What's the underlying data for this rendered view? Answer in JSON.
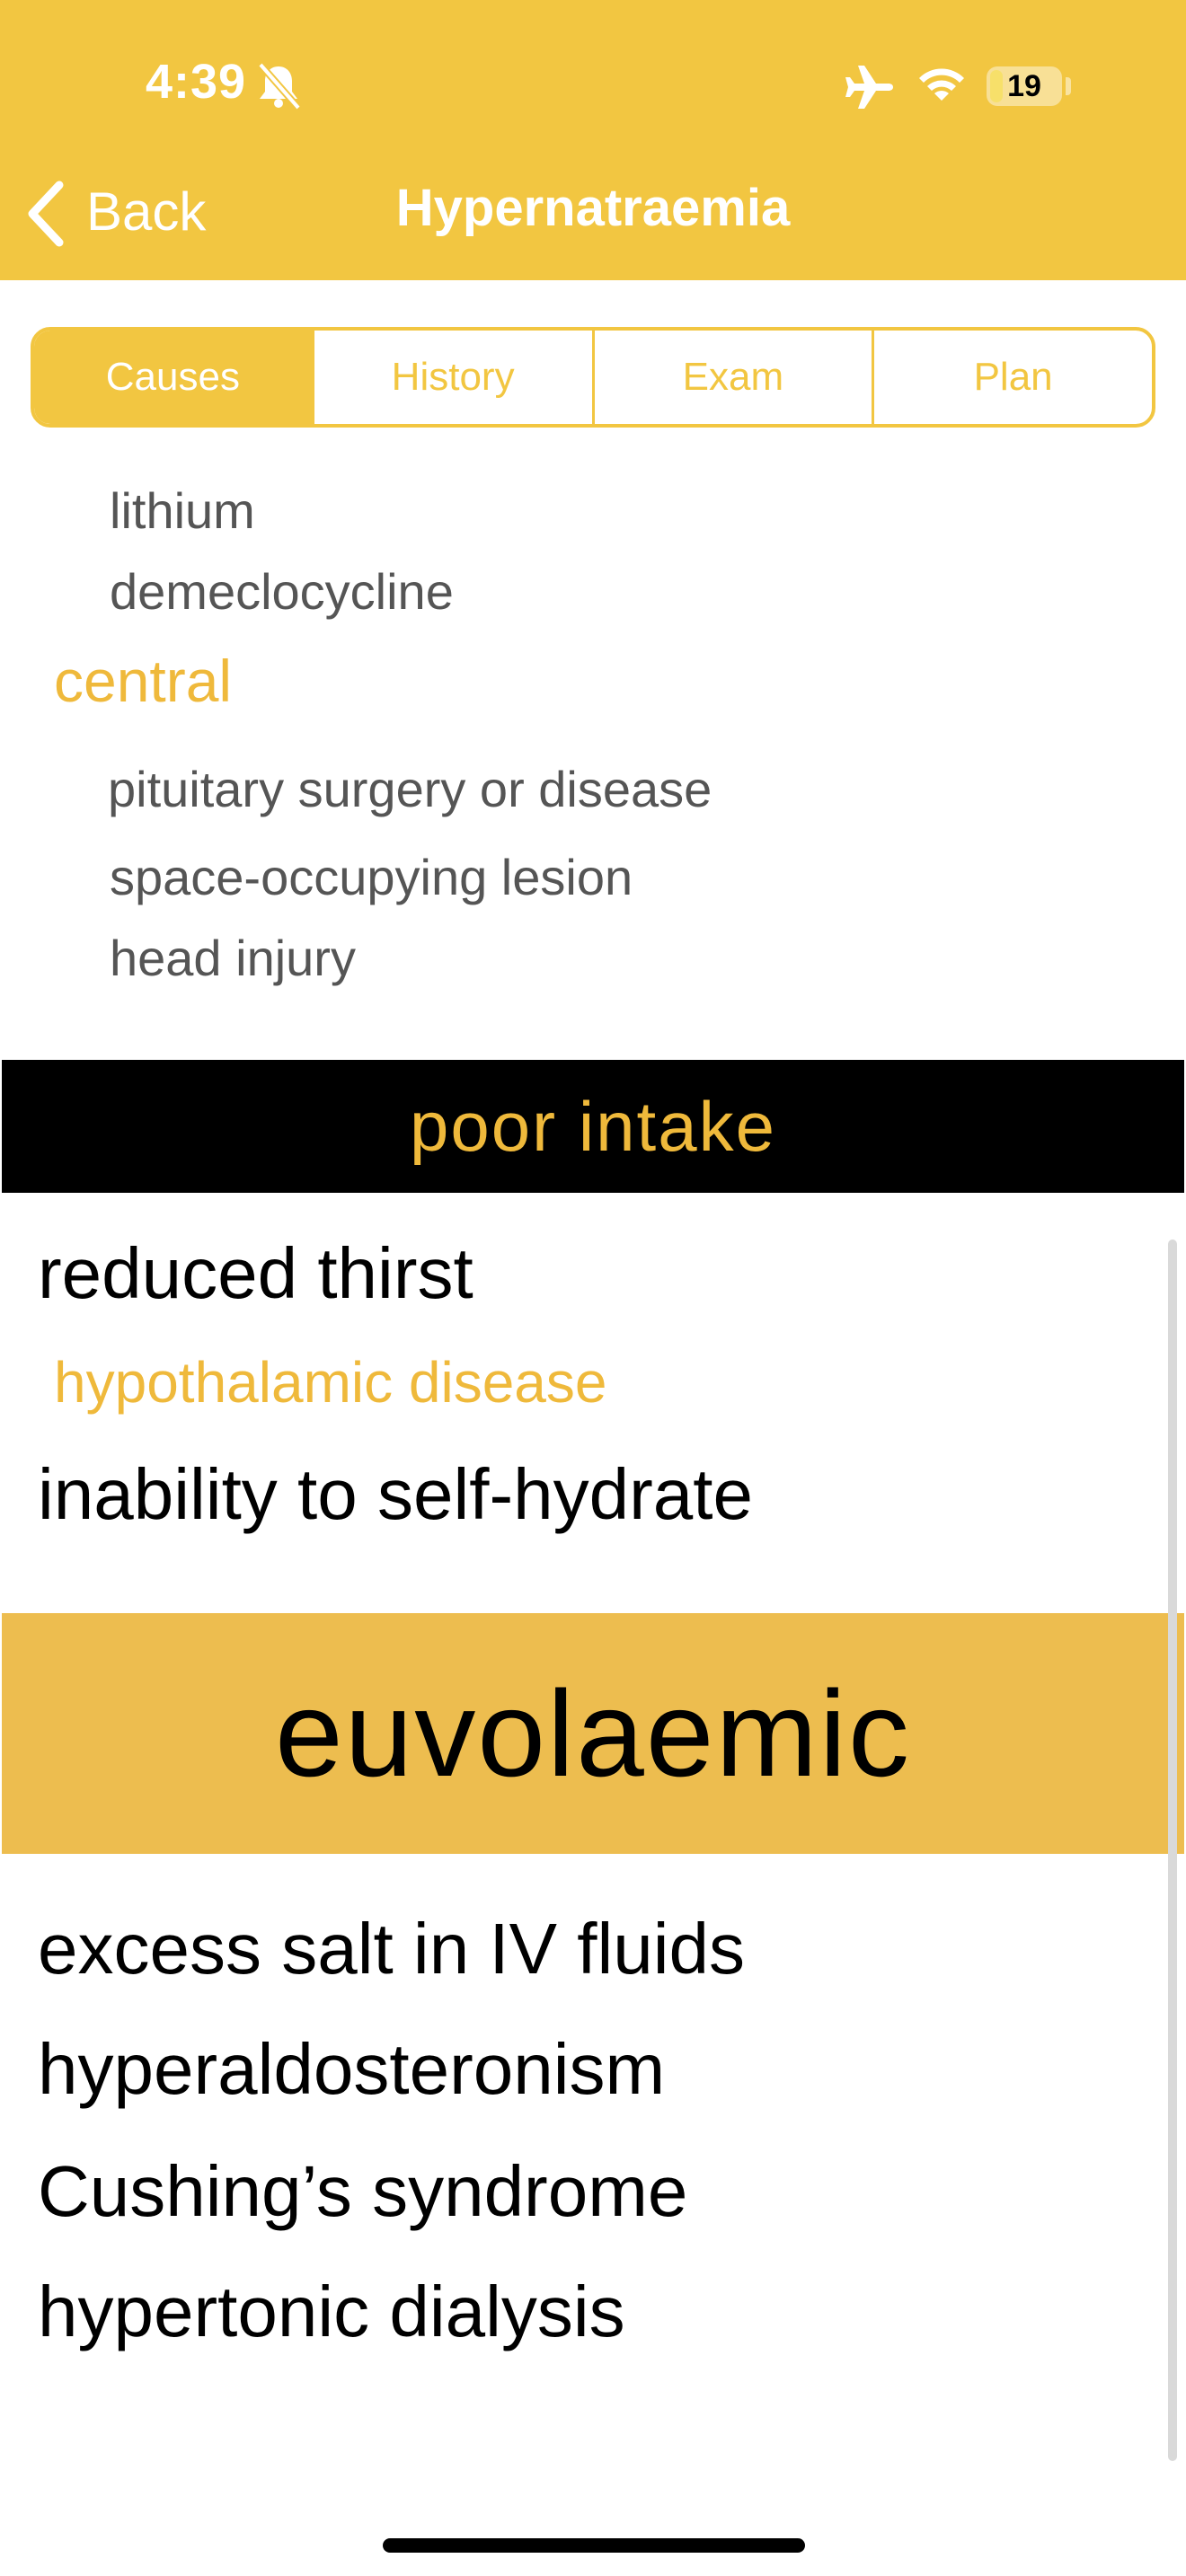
{
  "status_bar": {
    "time": "4:39",
    "battery": "19",
    "battery_level_percent": 19,
    "icons": [
      "bell-slash-icon",
      "airplane-icon",
      "wifi-icon",
      "battery-icon"
    ]
  },
  "nav": {
    "back_label": "Back",
    "title": "Hypernatraemia"
  },
  "tabs": [
    {
      "label": "Causes",
      "active": true
    },
    {
      "label": "History",
      "active": false
    },
    {
      "label": "Exam",
      "active": false
    },
    {
      "label": "Plan",
      "active": false
    }
  ],
  "content": {
    "nephrogenic_items": [
      "lithium",
      "demeclocycline"
    ],
    "central_label": "central",
    "central_items": [
      "pituitary surgery or disease",
      "space-occupying lesion",
      "head injury"
    ],
    "poor_intake_header": "poor intake",
    "reduced_thirst": "reduced thirst",
    "hypothalamic_label": "hypothalamic disease",
    "inability": "inability to self-hydrate",
    "euvolaemic_header": "euvolaemic",
    "euvolaemic_items": [
      "excess salt in IV fluids",
      "hyperaldosteronism",
      "Cushing’s syndrome",
      "hypertonic dialysis"
    ]
  },
  "colors": {
    "accent": "#F2C641",
    "section_gold": "#EDBD4F",
    "label_gold": "#EFB93B",
    "black_band": "#000000",
    "secondary_text": "#555555"
  }
}
